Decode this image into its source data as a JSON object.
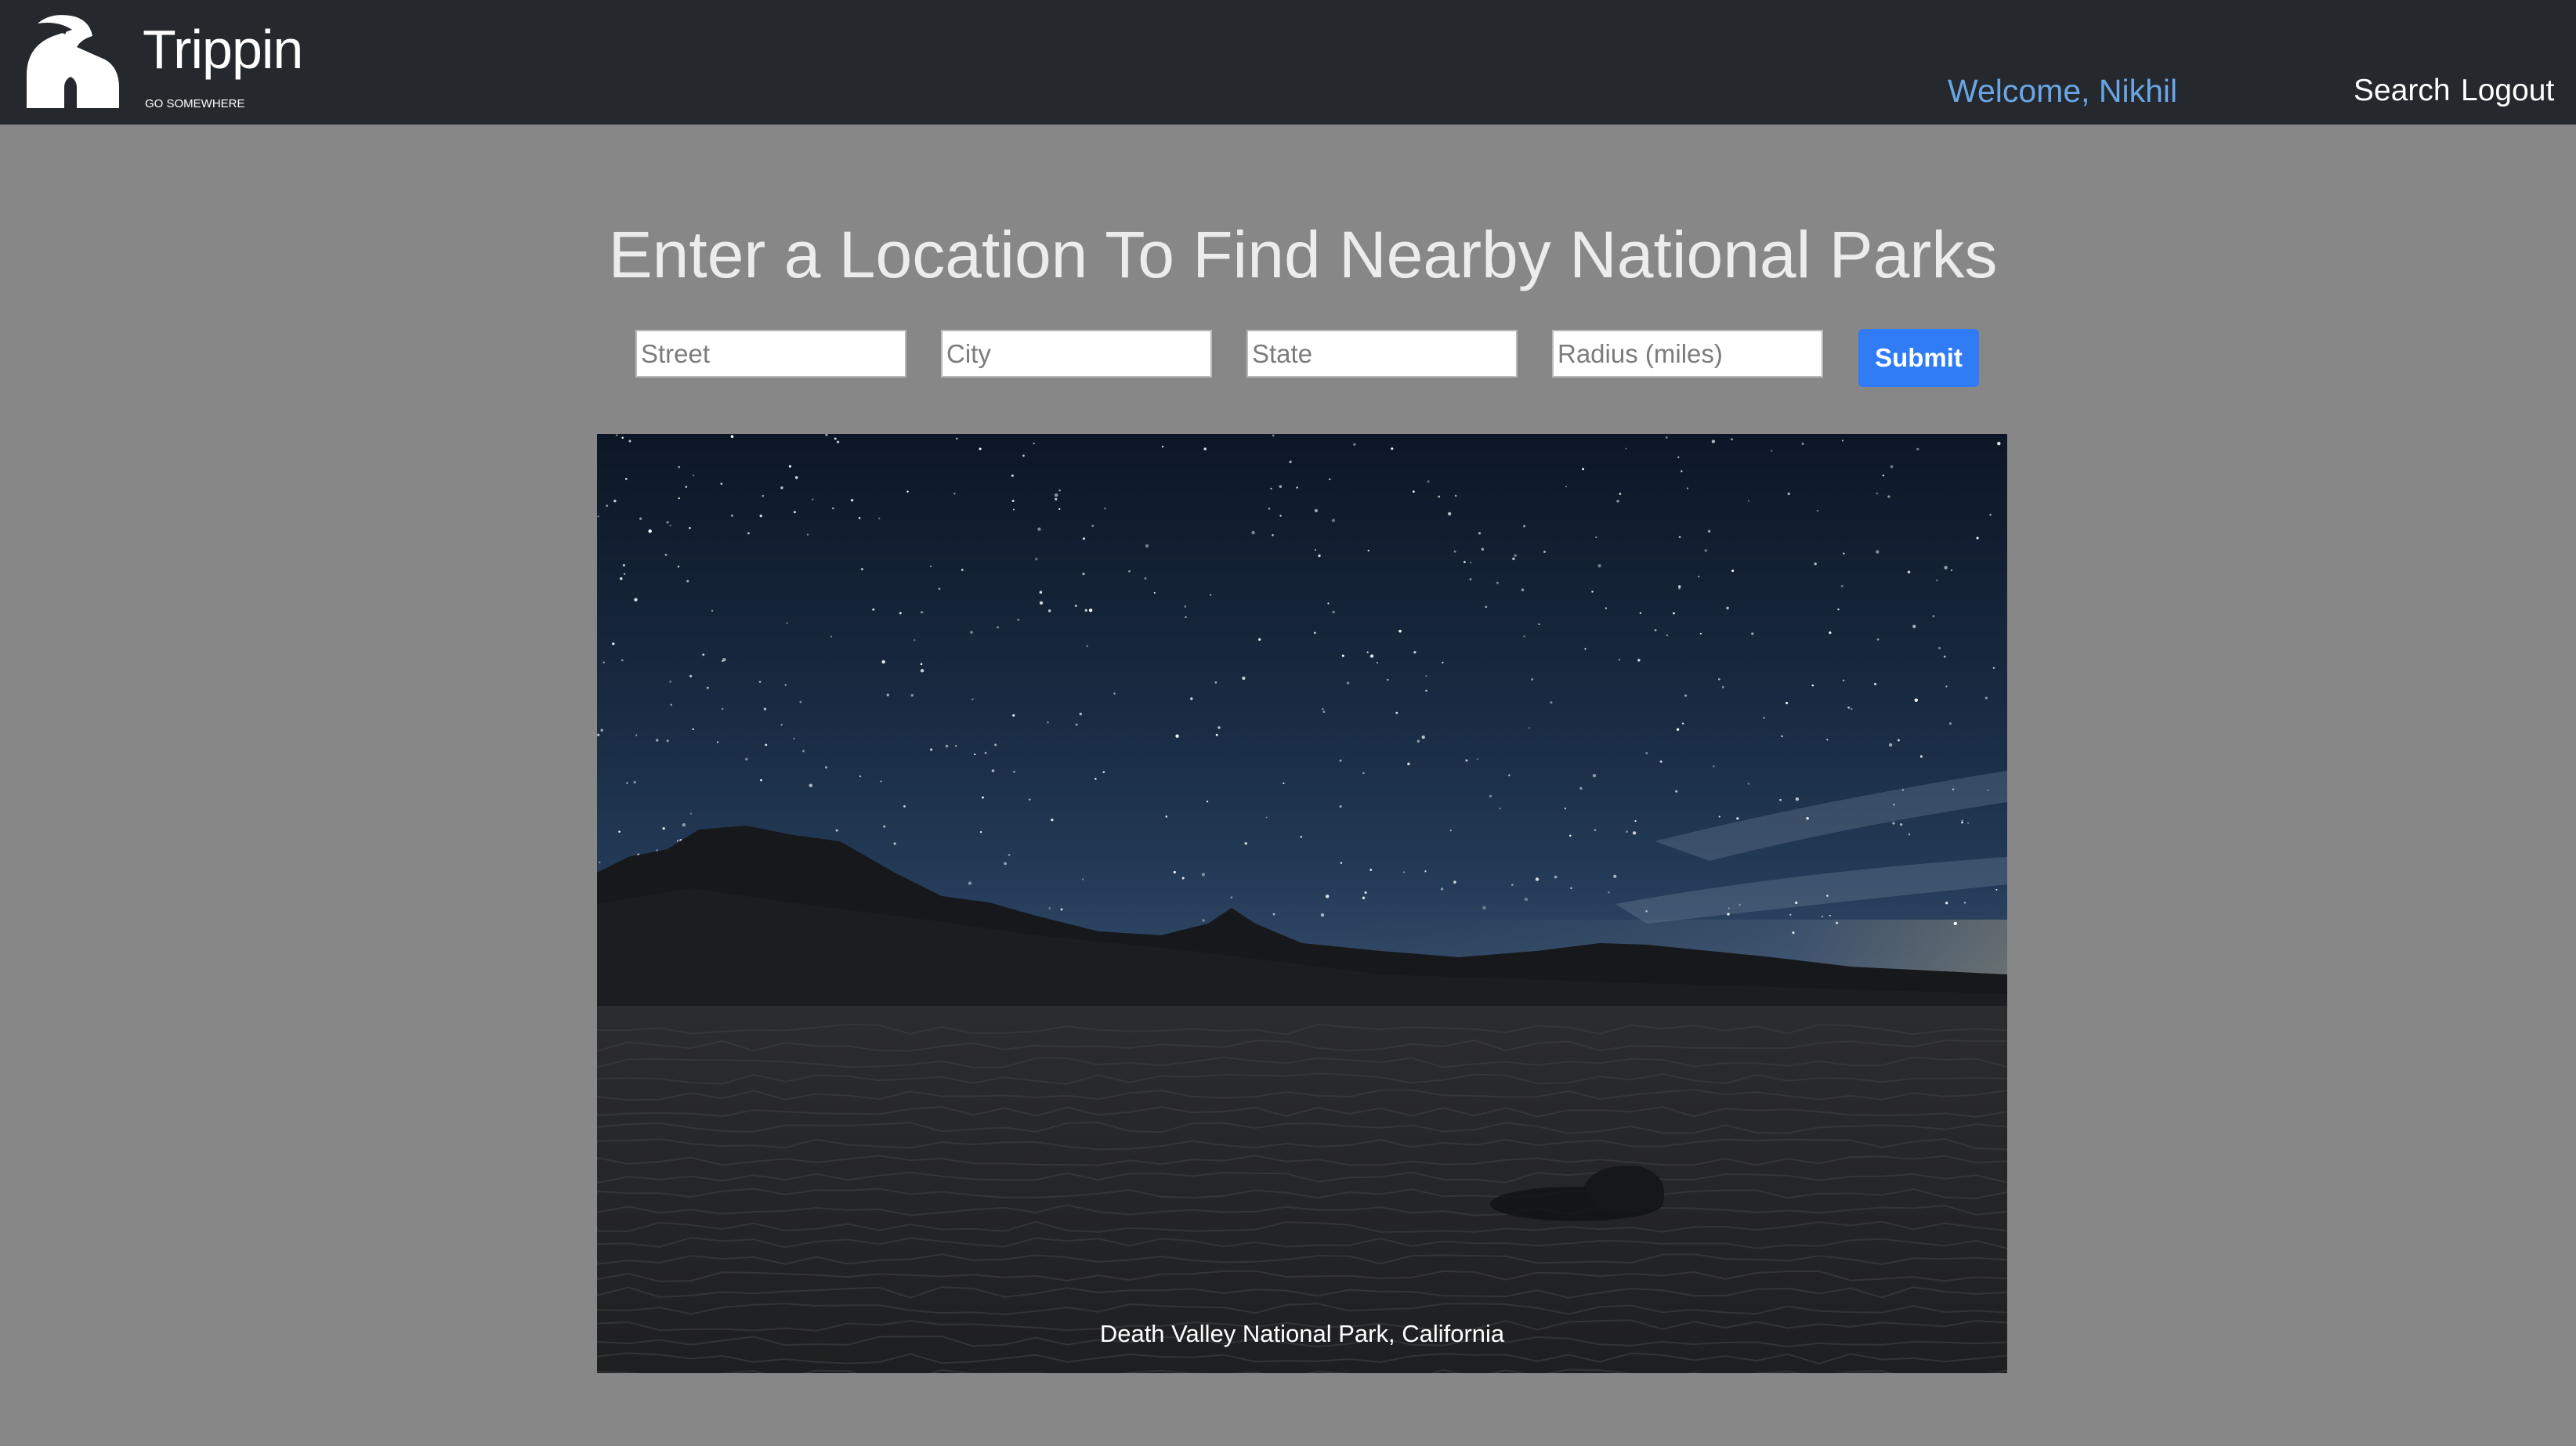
{
  "brand": {
    "name": "Trippin",
    "tagline": "GO SOMEWHERE",
    "logo_icon": "winding-road-icon"
  },
  "header": {
    "welcome": "Welcome, Nikhil",
    "nav": {
      "search": "Search",
      "logout": "Logout"
    }
  },
  "main": {
    "heading": "Enter a Location To Find Nearby National Parks",
    "form": {
      "street_placeholder": "Street",
      "city_placeholder": "City",
      "state_placeholder": "State",
      "radius_placeholder": "Radius (miles)",
      "submit_label": "Submit"
    },
    "hero": {
      "caption": "Death Valley National Park, California"
    }
  },
  "colors": {
    "navbar_bg": "#25282d",
    "page_bg": "#878787",
    "welcome_text": "#6aa6e6",
    "submit_bg": "#2f7cf6"
  }
}
